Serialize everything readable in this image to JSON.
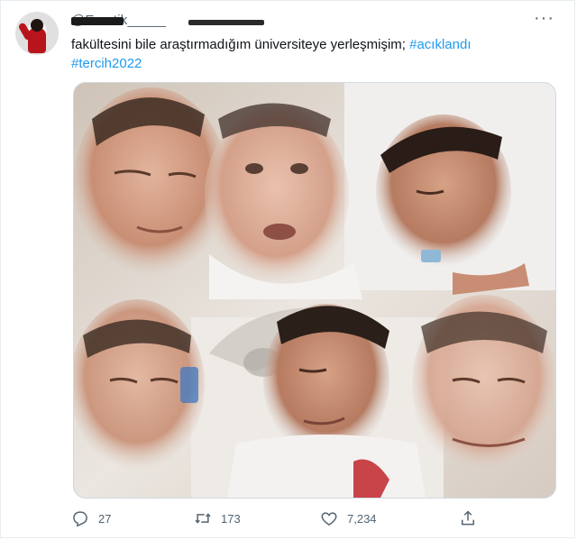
{
  "tweet": {
    "handle": "@Ematik_____",
    "text_prefix": "fakültesini bile araştırmadığım üniversiteye yerleşmişim; ",
    "hashtag1": "#acıklandı",
    "hashtag2": "#tercih2022",
    "more_label": "···"
  },
  "actions": {
    "reply_count": "27",
    "retweet_count": "173",
    "like_count": "7,234"
  },
  "colors": {
    "link": "#1d9bf0",
    "muted": "#536471",
    "text": "#0f1419"
  },
  "icons": [
    "avatar",
    "more-icon",
    "reply-icon",
    "retweet-icon",
    "like-icon",
    "share-icon"
  ]
}
